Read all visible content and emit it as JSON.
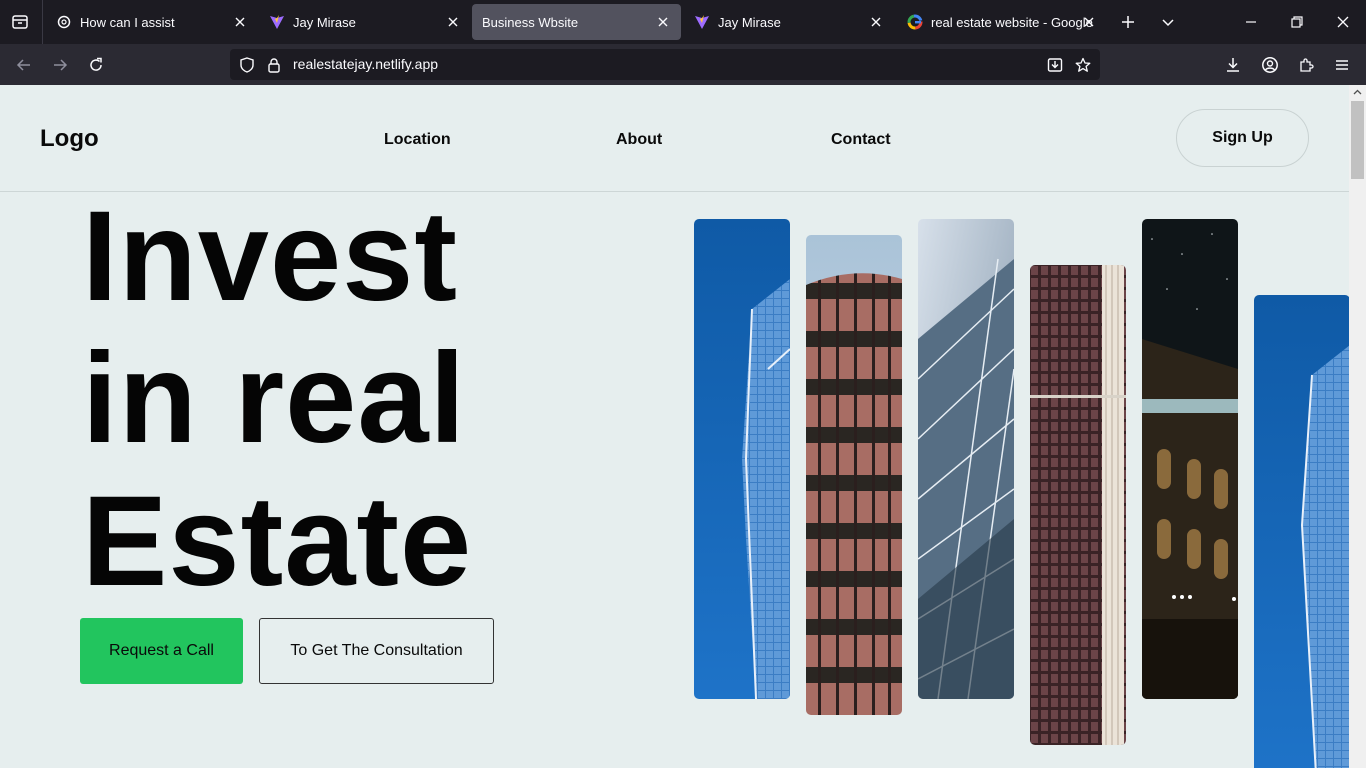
{
  "browser": {
    "tabs": [
      {
        "title": "How can I assist",
        "icon": "openai-icon",
        "active": false
      },
      {
        "title": "Jay Mirase",
        "icon": "vite-icon",
        "active": false
      },
      {
        "title": "Business Wbsite",
        "icon": "none",
        "active": true
      },
      {
        "title": "Jay Mirase",
        "icon": "vite-icon",
        "active": false
      },
      {
        "title": "real estate website - Google S",
        "icon": "google-icon",
        "active": false
      }
    ],
    "url": "realestatejay.netlify.app"
  },
  "site": {
    "logo": "Logo",
    "nav": [
      "Location",
      "About",
      "Contact"
    ],
    "signup_label": "Sign Up",
    "hero_lines": [
      "Invest",
      "in real",
      "Estate"
    ],
    "cta_primary": "Request a Call",
    "cta_secondary": "To Get The Consultation",
    "accent_color": "#22c55e"
  }
}
